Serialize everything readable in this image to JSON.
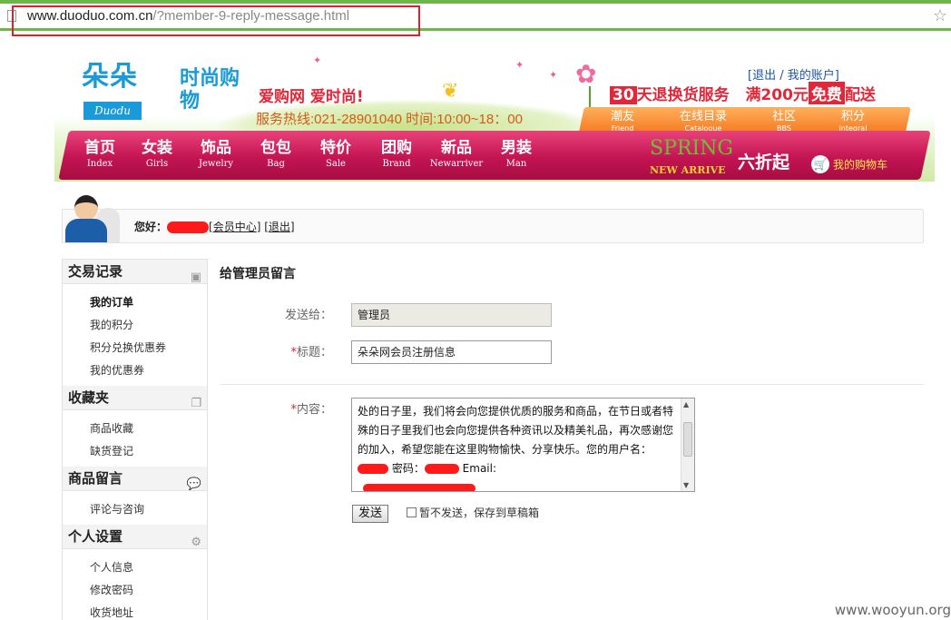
{
  "address_bar": {
    "domain": "www.duoduo.com.cn",
    "path": "/?member-9-reply-message.html"
  },
  "header": {
    "logo_cn_a": "朵朵",
    "logo_cn_b": "时尚购物",
    "logo_en": "Duodu",
    "slogan": "爱购网   爱时尚!",
    "hotline": "服务热线:021-28901040 时间:10:00~18：00",
    "account_links": {
      "logout": "退出",
      "sep": " / ",
      "my_account": "我的账户"
    },
    "promo": {
      "days": "30",
      "text1": "天退换货服务",
      "text2": "满200元",
      "free": "免费",
      "text3": "配送"
    },
    "orange_nav": [
      {
        "cn": "潮友",
        "en": "Friend"
      },
      {
        "cn": "在线目录",
        "en": "Catalogue"
      },
      {
        "cn": "社区",
        "en": "BBS"
      },
      {
        "cn": "积分",
        "en": "integral"
      }
    ],
    "main_nav": [
      {
        "cn": "首页",
        "en": "Index"
      },
      {
        "cn": "女装",
        "en": "Girls"
      },
      {
        "cn": "饰品",
        "en": "Jewelry"
      },
      {
        "cn": "包包",
        "en": "Bag"
      },
      {
        "cn": "特价",
        "en": "Sale"
      },
      {
        "cn": "团购",
        "en": "Brand"
      },
      {
        "cn": "新品",
        "en": "Newarriver"
      },
      {
        "cn": "男装",
        "en": "Man"
      }
    ],
    "spring": "SPRING",
    "new_arrive": "NEW ARRIVE",
    "discount": "六折起",
    "cart": "我的购物车"
  },
  "userbar": {
    "hello": "您好：",
    "member_center": "会员中心",
    "logout": "退出"
  },
  "sidebar": {
    "sections": [
      {
        "title": "交易记录",
        "icon": "archive-icon",
        "items": [
          "我的订单",
          "我的积分",
          "积分兑换优惠券",
          "我的优惠券"
        ]
      },
      {
        "title": "收藏夹",
        "icon": "folders-icon",
        "items": [
          "商品收藏",
          "缺货登记"
        ]
      },
      {
        "title": "商品留言",
        "icon": "speech-bubble-icon",
        "items": [
          "评论与咨询"
        ]
      },
      {
        "title": "个人设置",
        "icon": "gear-icon",
        "items": [
          "个人信息",
          "修改密码",
          "收货地址"
        ]
      }
    ]
  },
  "form": {
    "title": "给管理员留言",
    "to_label": "发送给：",
    "to_value": "管理员",
    "subject_label": "标题：",
    "subject_value": "朵朵网会员注册信息",
    "content_label": "内容：",
    "content_text": "处的日子里，我们将会向您提供优质的服务和商品，在节日或者特殊的日子里我们也会向您提供各种资讯以及精美礼品，再次感谢您的加入，希望您能在这里购物愉快、分享快乐。您的用户名：",
    "password_label": "密码：",
    "email_label": "Email:",
    "send": "发送",
    "draft": "暂不发送，保存到草稿箱"
  },
  "watermark": "www.wooyun.org"
}
